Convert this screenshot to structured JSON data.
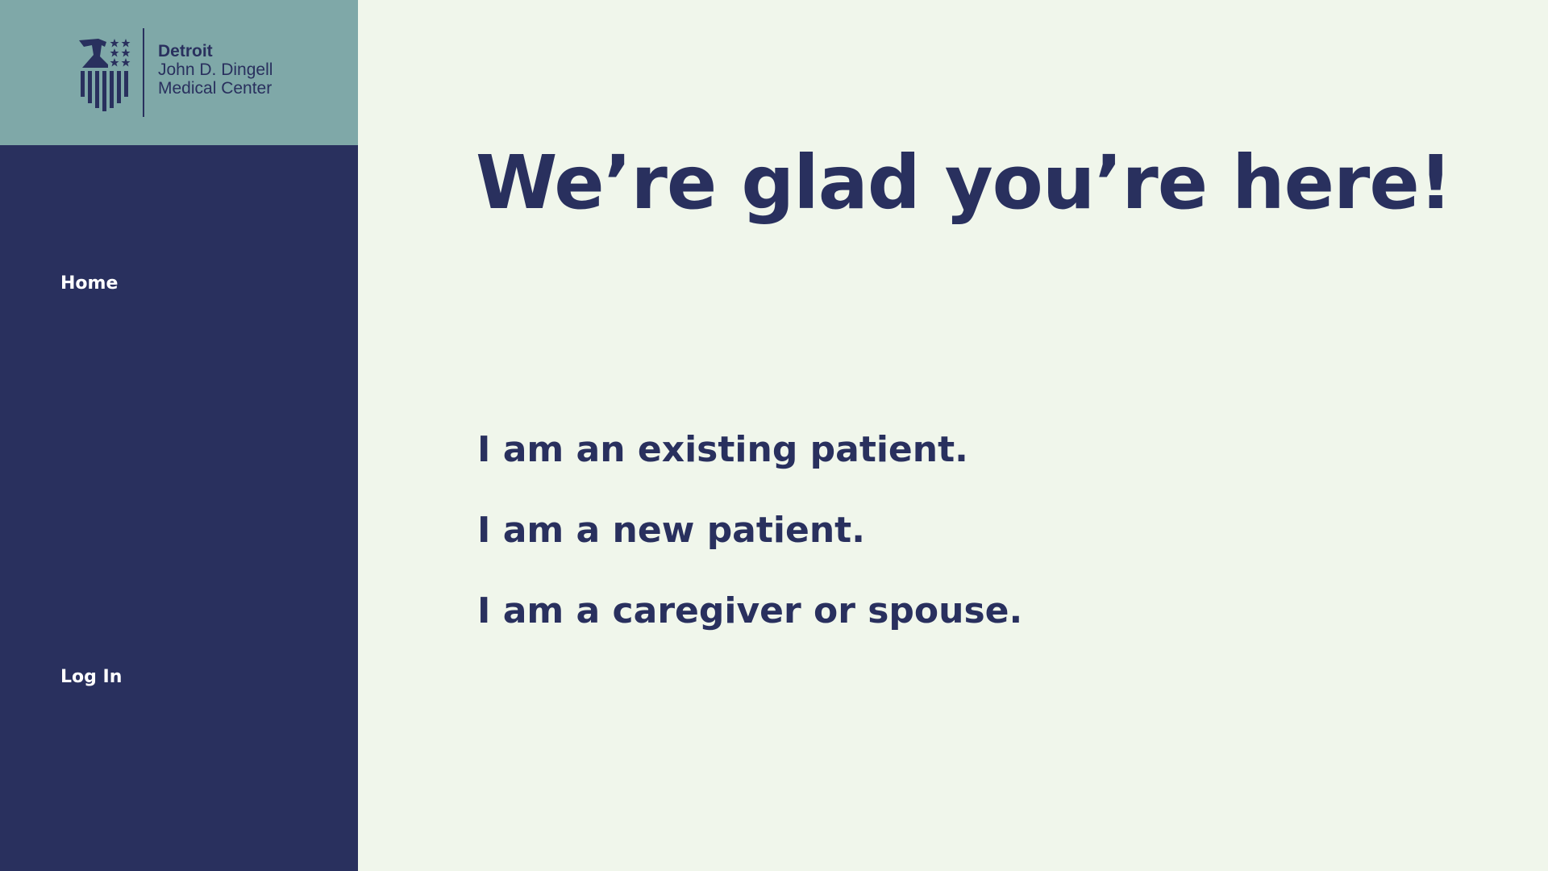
{
  "brand": {
    "line1": "Detroit",
    "line2": "John D. Dingell",
    "line3": "Medical Center",
    "logo_icon": "eagle-shield-stars-icon"
  },
  "nav": {
    "home": "Home",
    "login": "Log In"
  },
  "main": {
    "headline": "We’re glad you’re here!",
    "choices": [
      "I am an existing patient.",
      "I am a new patient.",
      "I am a caregiver or spouse."
    ]
  },
  "colors": {
    "navy": "#29305e",
    "logo_panel": "#7fa8a8",
    "background": "#f0f6eb",
    "nav_text": "#ffffff"
  }
}
